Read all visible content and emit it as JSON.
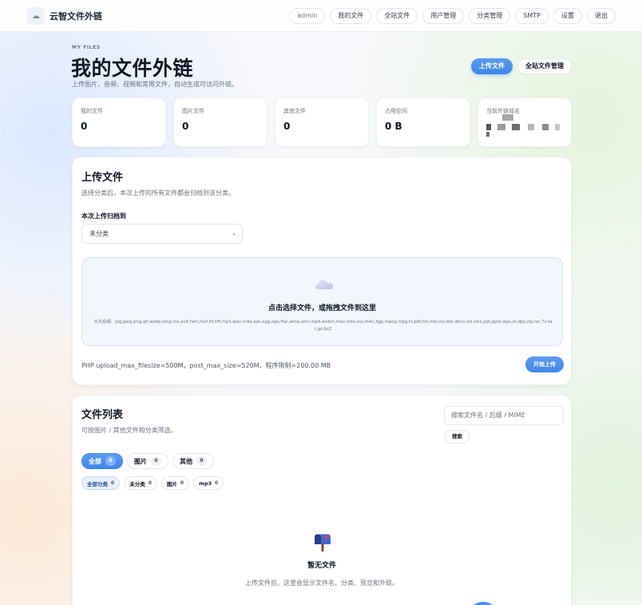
{
  "brand": {
    "name": "云智文件外链",
    "logo_icon": "cloud-logo-icon"
  },
  "nav": [
    {
      "label": "admin"
    },
    {
      "label": "我的文件"
    },
    {
      "label": "全站文件"
    },
    {
      "label": "用户管理"
    },
    {
      "label": "分类管理"
    },
    {
      "label": "SMTP"
    },
    {
      "label": "设置"
    },
    {
      "label": "退出"
    }
  ],
  "header": {
    "eyebrow": "MY FILES",
    "title": "我的文件外链",
    "subtitle": "上传图片、音频、视频和常用文件，自动生成可访问外链。",
    "upload_button": "上传文件",
    "site_files_button": "全站文件管理"
  },
  "stats": [
    {
      "label": "我的文件",
      "value": "0"
    },
    {
      "label": "图片文件",
      "value": "0"
    },
    {
      "label": "其他文件",
      "value": "0"
    },
    {
      "label": "占用空间",
      "value": "0 B"
    },
    {
      "label": "当前外链域名",
      "value": ""
    }
  ],
  "upload": {
    "title": "上传文件",
    "description": "选择分类后，本次上传的所有文件都会归档到该分类。",
    "category_label": "本次上传归档到",
    "category_value": "未分类",
    "drop_title": "点击选择文件，或拖拽文件到这里",
    "allowed_formats": "允许后缀：jpg,jpeg,png,gif,webp,bmp,ico,avif,heic,heif,tif,tiff,mp3,wav,m4a,aac,ogg,oga,flac,wma,amr,mp4,webm,mov,mkv,avi,m4v,3gp,mpeg,mpg,ts,pdf,txt,md,csv,doc,docx,xls,xlsx,ppt,pptx,wps,et,dps,zip,rar,7z,tar,gz,bz2",
    "limits": "PHP upload_max_filesize=500M，post_max_size=520M，程序限制=200.00 MB",
    "start_button": "开始上传"
  },
  "file_list": {
    "title": "文件列表",
    "description": "可按图片 / 其他文件和分类筛选。",
    "search_placeholder": "搜索文件名 / 后缀 / MIME",
    "search_button": "搜索",
    "type_tabs": [
      {
        "label": "全部",
        "count": "0"
      },
      {
        "label": "图片",
        "count": "0"
      },
      {
        "label": "其他",
        "count": "0"
      }
    ],
    "category_tabs": [
      {
        "label": "全部分类",
        "count": "0"
      },
      {
        "label": "未分类",
        "count": "0"
      },
      {
        "label": "图片",
        "count": "0"
      },
      {
        "label": "mp3",
        "count": "0"
      }
    ],
    "empty_title": "暂无文件",
    "empty_description": "上传文件后，这里会显示文件名、分类、预览和外链。"
  },
  "colors": {
    "accent": "#3f86ea",
    "dropzone_bg": "#f2f6fd"
  }
}
